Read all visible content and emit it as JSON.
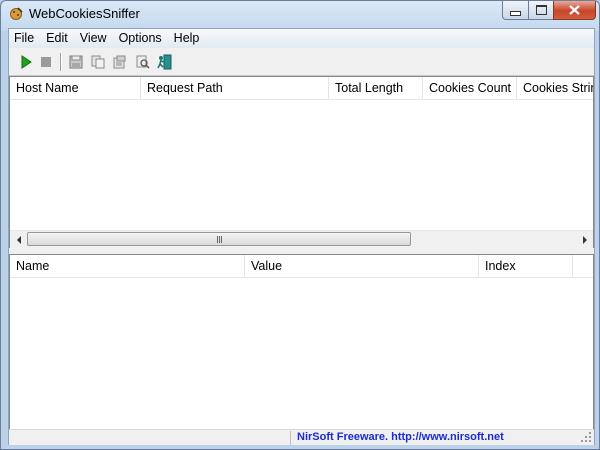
{
  "window": {
    "title": "WebCookiesSniffer"
  },
  "menu": [
    "File",
    "Edit",
    "View",
    "Options",
    "Help"
  ],
  "toolbar": {
    "buttons": [
      {
        "name": "start-capture",
        "icon": "play-icon"
      },
      {
        "name": "stop-capture",
        "icon": "stop-icon"
      },
      {
        "name": "save",
        "icon": "save-icon"
      },
      {
        "name": "copy",
        "icon": "copy-icon"
      },
      {
        "name": "properties",
        "icon": "properties-icon"
      },
      {
        "name": "find",
        "icon": "find-icon"
      },
      {
        "name": "exit",
        "icon": "exit-icon"
      }
    ]
  },
  "top_table": {
    "columns": [
      "Host Name",
      "Request Path",
      "Total Length",
      "Cookies Count",
      "Cookies String"
    ],
    "rows": []
  },
  "bottom_table": {
    "columns": [
      "Name",
      "Value",
      "Index"
    ],
    "rows": []
  },
  "status": {
    "link_text": "NirSoft Freeware.  http://www.nirsoft.net"
  },
  "colors": {
    "link": "#1a2bd6",
    "play": "#1aa51a"
  }
}
